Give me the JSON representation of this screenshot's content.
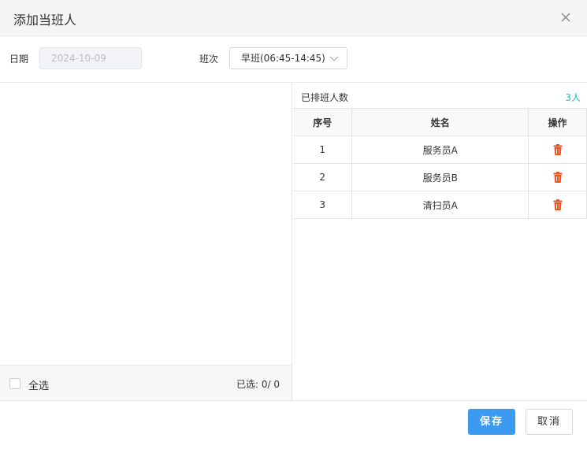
{
  "dialog": {
    "title": "添加当班人"
  },
  "filters": {
    "date_label": "日期",
    "date_value": "2024-10-09",
    "shift_label": "班次",
    "shift_value": "早班(06:45-14:45)"
  },
  "left": {
    "select_all_label": "全选",
    "selected_count": "已选: 0/ 0"
  },
  "right": {
    "header_title": "已排班人数",
    "header_count": "3人",
    "columns": [
      "序号",
      "姓名",
      "操作"
    ],
    "rows": [
      {
        "index": "1",
        "name": "服务员A"
      },
      {
        "index": "2",
        "name": "服务员B"
      },
      {
        "index": "3",
        "name": "清扫员A"
      }
    ]
  },
  "footer": {
    "save_label": "保存",
    "cancel_label": "取消"
  },
  "colors": {
    "primary": "#3a9bf0",
    "accent_count": "#22b8c8",
    "delete": "#f0511e"
  },
  "icons": {
    "close": "close-icon",
    "chevron": "chevron-down-icon",
    "delete": "trash-icon"
  }
}
